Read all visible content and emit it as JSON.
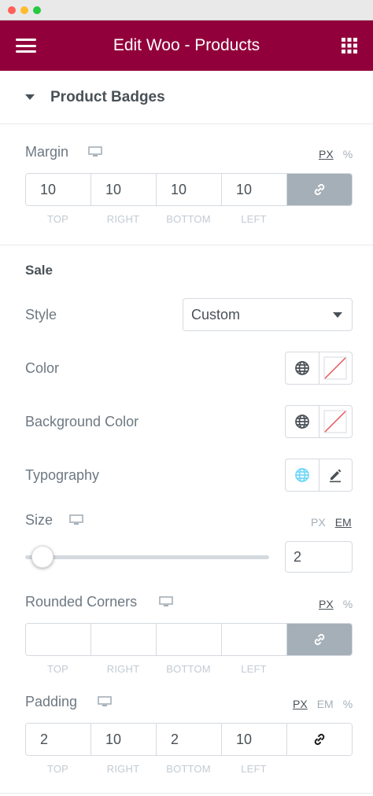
{
  "colors": {
    "brand": "#92003b",
    "dot_red": "#fe5f57",
    "dot_yellow": "#febc2e",
    "dot_green": "#28c840",
    "link_active": "#a4afb7",
    "globe_blue": "#71d7f7"
  },
  "header": {
    "title": "Edit Woo - Products",
    "menu_icon": "hamburger-icon",
    "widgets_icon": "grid-icon"
  },
  "section": {
    "title": "Product Badges",
    "caret_icon": "caret-down-icon"
  },
  "margin": {
    "label": "Margin",
    "units": [
      "PX",
      "%"
    ],
    "active_unit": "PX",
    "values": [
      "10",
      "10",
      "10",
      "10"
    ],
    "labels": [
      "TOP",
      "RIGHT",
      "BOTTOM",
      "LEFT"
    ]
  },
  "sale": {
    "heading": "Sale",
    "style": {
      "label": "Style",
      "value": "Custom"
    },
    "color": {
      "label": "Color"
    },
    "background_color": {
      "label": "Background Color"
    },
    "typography": {
      "label": "Typography"
    },
    "size": {
      "label": "Size",
      "units": [
        "PX",
        "EM"
      ],
      "active_unit": "EM",
      "value": "2",
      "slider_fraction": 0.07
    },
    "rounded_corners": {
      "label": "Rounded Corners",
      "units": [
        "PX",
        "%"
      ],
      "active_unit": "PX",
      "values": [
        "",
        "",
        "",
        ""
      ],
      "labels": [
        "TOP",
        "RIGHT",
        "BOTTOM",
        "LEFT"
      ]
    },
    "padding": {
      "label": "Padding",
      "units": [
        "PX",
        "EM",
        "%"
      ],
      "active_unit": "PX",
      "values": [
        "2",
        "10",
        "2",
        "10"
      ],
      "labels": [
        "TOP",
        "RIGHT",
        "BOTTOM",
        "LEFT"
      ]
    }
  }
}
